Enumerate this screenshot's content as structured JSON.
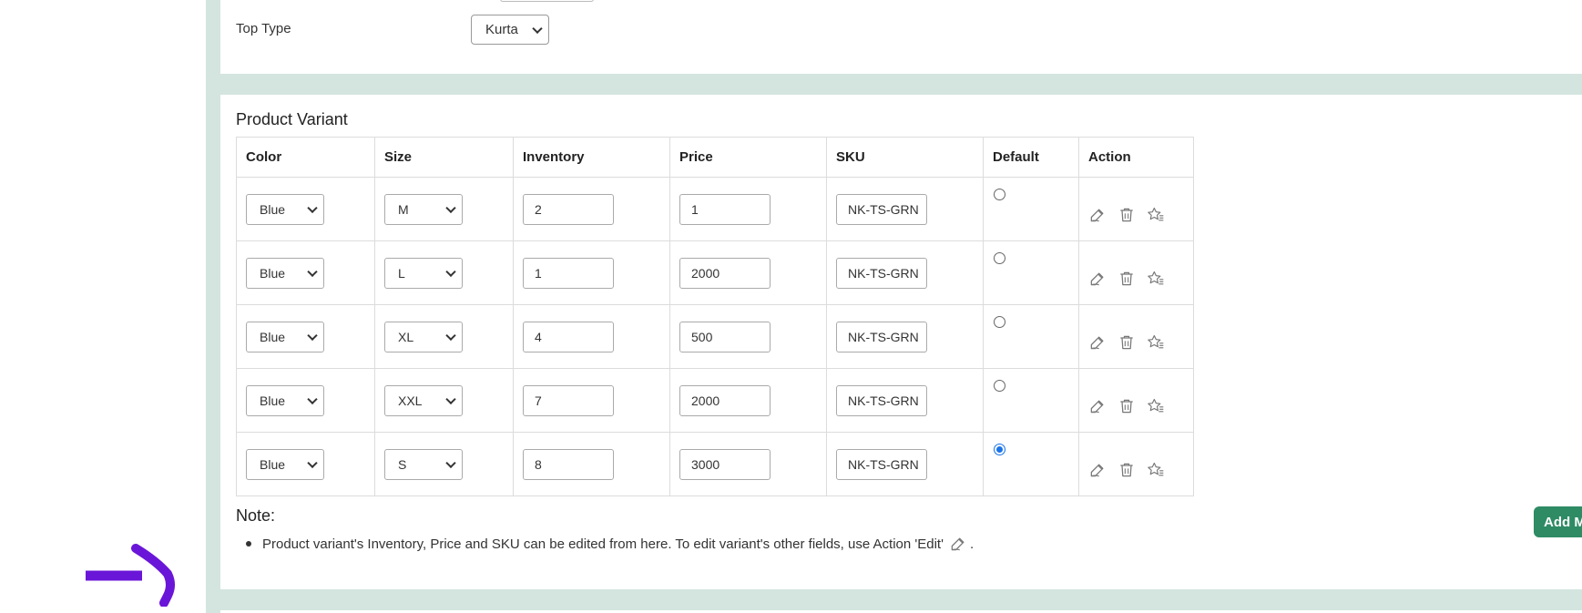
{
  "top": {
    "top_type_label": "Top Type",
    "top_type_value": "Kurta"
  },
  "variants": {
    "title": "Product Variant",
    "columns": [
      "Color",
      "Size",
      "Inventory",
      "Price",
      "SKU",
      "Default",
      "Action"
    ],
    "rows": [
      {
        "color": "Blue",
        "size": "M",
        "inventory": "2",
        "price": "1",
        "sku": "NK-TS-GRN",
        "default": false
      },
      {
        "color": "Blue",
        "size": "L",
        "inventory": "1",
        "price": "2000",
        "sku": "NK-TS-GRN",
        "default": false
      },
      {
        "color": "Blue",
        "size": "XL",
        "inventory": "4",
        "price": "500",
        "sku": "NK-TS-GRN",
        "default": false
      },
      {
        "color": "Blue",
        "size": "XXL",
        "inventory": "7",
        "price": "2000",
        "sku": "NK-TS-GRN",
        "default": false
      },
      {
        "color": "Blue",
        "size": "S",
        "inventory": "8",
        "price": "3000",
        "sku": "NK-TS-GRN",
        "default": true
      }
    ]
  },
  "note": {
    "title": "Note:",
    "text_before": "Product variant's Inventory, Price and SKU can be edited from here. To edit variant's other fields, use Action 'Edit'",
    "text_after": "."
  },
  "add_button_label": "Add M",
  "colors": {
    "panel_bg": "#d4e5df",
    "accent_green": "#2e8b64",
    "radio_checked": "#1a73e8",
    "arrow": "#6a16d8"
  },
  "icons": {
    "edit": "edit-icon",
    "delete": "trash-icon",
    "set_default": "star-list-icon",
    "annotation": "purple-arrow"
  }
}
